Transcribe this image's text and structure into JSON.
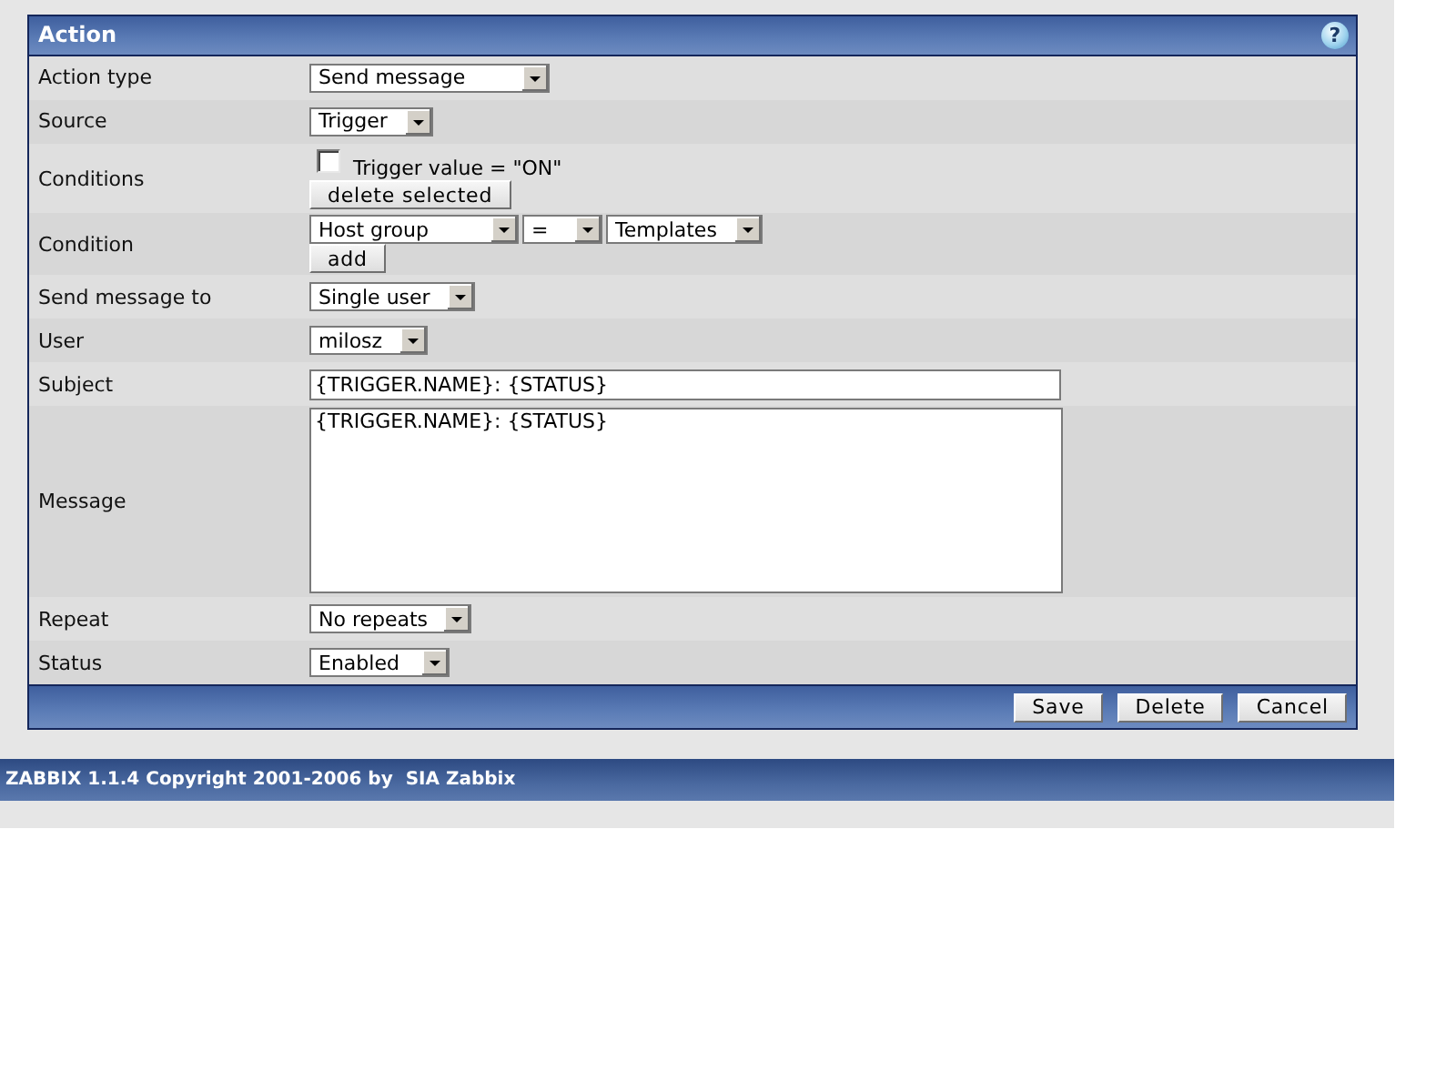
{
  "title": "Action",
  "help": "?",
  "rows": [
    {
      "label": "Action type",
      "kind": "select",
      "value": "Send message"
    },
    {
      "label": "Source",
      "kind": "select",
      "value": "Trigger"
    },
    {
      "label": "Conditions",
      "kind": "conditions",
      "items": [
        {
          "text": "Trigger value = \"ON\"",
          "checked": false
        }
      ],
      "button": "delete selected"
    },
    {
      "label": "Condition",
      "kind": "condition",
      "selects": [
        "Host group",
        "=",
        "Templates"
      ],
      "button": "add"
    },
    {
      "label": "Send message to",
      "kind": "select",
      "value": "Single user"
    },
    {
      "label": "User",
      "kind": "select",
      "value": "milosz"
    },
    {
      "label": "Subject",
      "kind": "input",
      "value": "{TRIGGER.NAME}: {STATUS}"
    },
    {
      "label": "Message",
      "kind": "textarea",
      "value": "{TRIGGER.NAME}: {STATUS}"
    },
    {
      "label": "Repeat",
      "kind": "select",
      "value": "No repeats"
    },
    {
      "label": "Status",
      "kind": "select",
      "value": "Enabled"
    }
  ],
  "buttons": [
    "Save",
    "Delete",
    "Cancel"
  ],
  "footer": "ZABBIX 1.1.4 Copyright 2001-2006 by  SIA Zabbix"
}
